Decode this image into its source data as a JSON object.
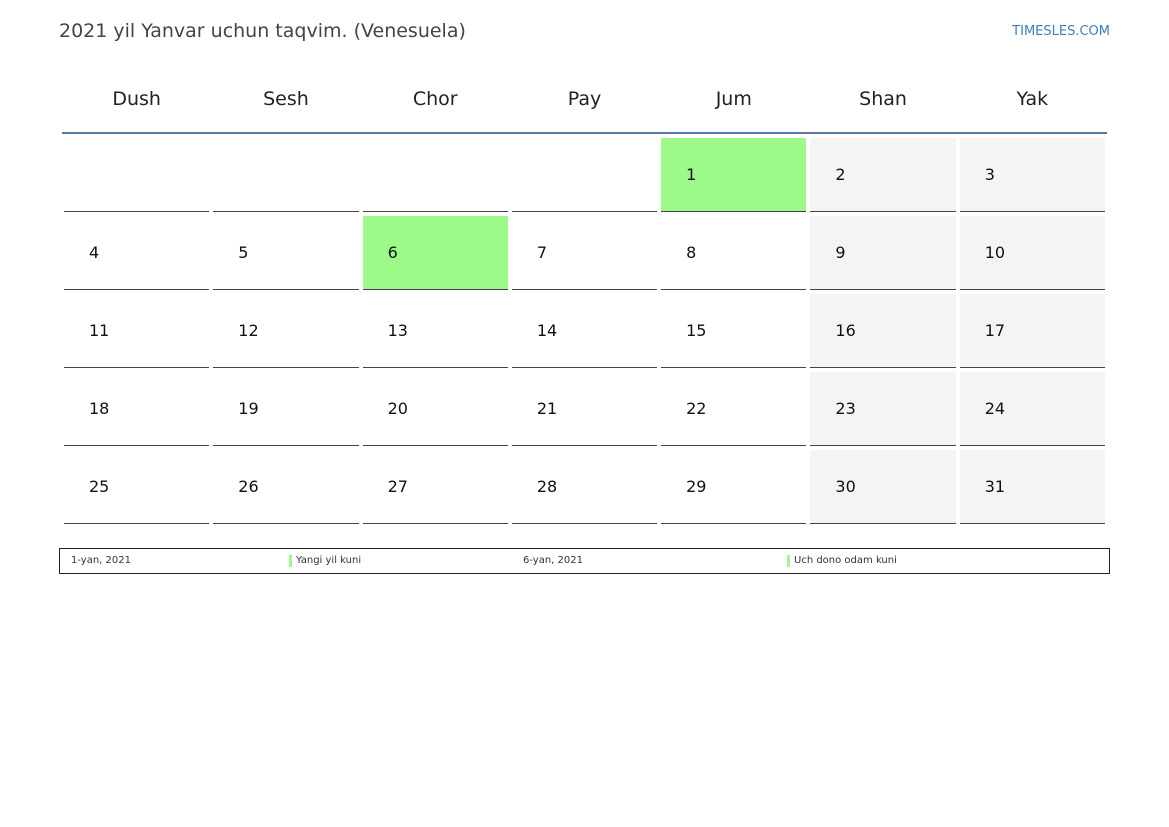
{
  "title": "2021 yil Yanvar uchun taqvim. (Venesuela)",
  "brand": "TIMESLES.COM",
  "colors": {
    "holiday": "#9dfa88",
    "weekend": "#f4f4f4",
    "header_rule": "#5a7aa0",
    "brand": "#3a7fc1"
  },
  "weekdays": [
    "Dush",
    "Sesh",
    "Chor",
    "Pay",
    "Jum",
    "Shan",
    "Yak"
  ],
  "weeks": [
    [
      "",
      "",
      "",
      "",
      "1",
      "2",
      "3"
    ],
    [
      "4",
      "5",
      "6",
      "7",
      "8",
      "9",
      "10"
    ],
    [
      "11",
      "12",
      "13",
      "14",
      "15",
      "16",
      "17"
    ],
    [
      "18",
      "19",
      "20",
      "21",
      "22",
      "23",
      "24"
    ],
    [
      "25",
      "26",
      "27",
      "28",
      "29",
      "30",
      "31"
    ]
  ],
  "holiday_days": [
    "1",
    "6"
  ],
  "legend": [
    {
      "date": "1-yan, 2021",
      "name": "Yangi yil kuni"
    },
    {
      "date": "6-yan, 2021",
      "name": "Uch dono odam kuni"
    }
  ]
}
